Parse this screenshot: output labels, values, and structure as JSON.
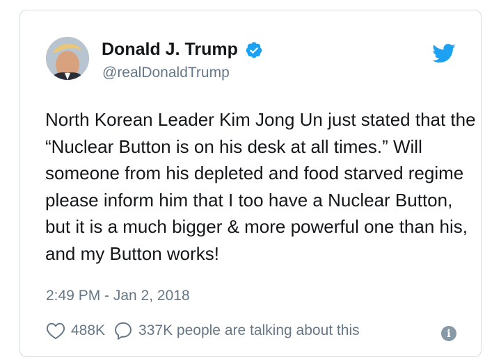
{
  "author": {
    "display_name": "Donald J. Trump",
    "handle": "@realDonaldTrump",
    "verified": true
  },
  "tweet": {
    "text": "North Korean Leader Kim Jong Un just stated that the “Nuclear Button is on his desk at all times.” Will someone from his depleted and food starved regime please inform him that I too have a Nuclear Button, but it is a much bigger & more powerful one than his, and my Button works!",
    "timestamp": "2:49 PM - Jan 2, 2018"
  },
  "stats": {
    "likes": "488K",
    "talking": "337K people are talking about this"
  },
  "icons": {
    "brand": "twitter-bird-icon",
    "like": "heart-icon",
    "reply": "speech-bubble-icon",
    "info": "info-icon",
    "verified": "verified-badge-icon"
  },
  "colors": {
    "accent": "#1da1f2",
    "text": "#14171a",
    "muted": "#657786",
    "border": "#d6dbe0"
  }
}
